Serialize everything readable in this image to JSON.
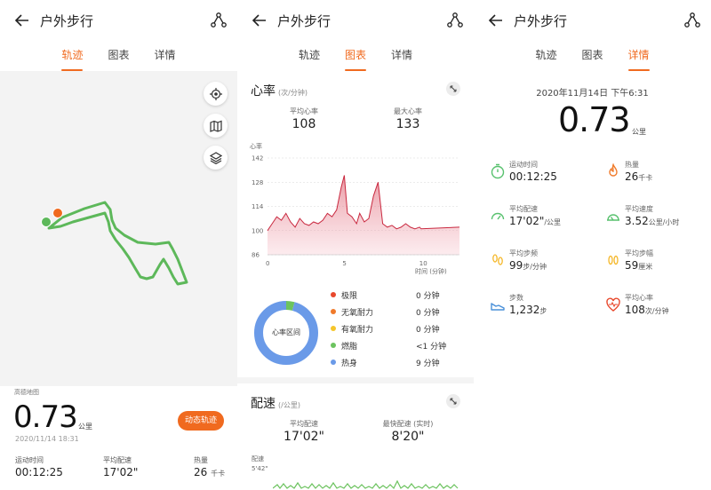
{
  "header": {
    "title": "户外步行"
  },
  "tabs": [
    "轨迹",
    "图表",
    "详情"
  ],
  "summary": {
    "map_source": "高德地图",
    "distance": "0.73",
    "unit": "公里",
    "date": "2020/11/14 18:31",
    "dynamic_button": "动态轨迹",
    "stats": [
      {
        "label": "运动时间",
        "value": "00:12:25",
        "unit": ""
      },
      {
        "label": "平均配速",
        "value": "17'02\"",
        "unit": ""
      },
      {
        "label": "热量",
        "value": "26",
        "unit": "千卡"
      }
    ]
  },
  "heart": {
    "title": "心率",
    "unit": "(次/分钟)",
    "avg_label": "平均心率",
    "avg_value": "108",
    "max_label": "最大心率",
    "max_value": "133",
    "axis_unit": "心率",
    "x_axis_unit": "时间 (分钟)",
    "donut_label": "心率区间",
    "zones": [
      {
        "name": "极限",
        "value": "0 分钟",
        "color": "#e8482c"
      },
      {
        "name": "无氧耐力",
        "value": "0 分钟",
        "color": "#f07a2a"
      },
      {
        "name": "有氧耐力",
        "value": "0 分钟",
        "color": "#f5c52b"
      },
      {
        "name": "燃脂",
        "value": "<1 分钟",
        "color": "#6cc35f"
      },
      {
        "name": "热身",
        "value": "9 分钟",
        "color": "#6a9ae8"
      }
    ]
  },
  "pace": {
    "title": "配速",
    "unit": "(/公里)",
    "avg_label": "平均配速",
    "avg_value": "17'02\"",
    "fast_label": "最快配速 (实时)",
    "fast_value": "8'20\"",
    "axis_unit": "配速",
    "axis_tick": "5'42\""
  },
  "detail": {
    "datetime": "2020年11月14日 下午6:31",
    "distance": "0.73",
    "unit": "公里",
    "metrics": [
      {
        "label": "运动时间",
        "value": "00:12:25",
        "unit": "",
        "icon": "stopwatch-icon",
        "color": "#58c16e"
      },
      {
        "label": "热量",
        "value": "26",
        "unit": "千卡",
        "icon": "flame-icon",
        "color": "#f07a2a"
      },
      {
        "label": "平均配速",
        "value": "17'02\"",
        "unit": "/公里",
        "icon": "speedometer-icon",
        "color": "#58c16e"
      },
      {
        "label": "平均速度",
        "value": "3.52",
        "unit": "公里/小时",
        "icon": "gauge-icon",
        "color": "#58c16e"
      },
      {
        "label": "平均步频",
        "value": "99",
        "unit": "步/分钟",
        "icon": "footprints-icon",
        "color": "#f5b82b"
      },
      {
        "label": "平均步幅",
        "value": "59",
        "unit": "厘米",
        "icon": "stride-icon",
        "color": "#f5b82b"
      },
      {
        "label": "步数",
        "value": "1,232",
        "unit": "步",
        "icon": "shoe-icon",
        "color": "#4a90d9"
      },
      {
        "label": "平均心率",
        "value": "108",
        "unit": "次/分钟",
        "icon": "heart-rate-icon",
        "color": "#e8482c"
      }
    ]
  },
  "chart_data": [
    {
      "type": "area",
      "title": "心率",
      "ylabel": "心率",
      "xlabel": "时间 (分钟)",
      "x_ticks": [
        0,
        5,
        10
      ],
      "y_ticks": [
        86,
        100,
        114,
        128,
        142
      ],
      "xlim": [
        0,
        12.5
      ],
      "ylim": [
        86,
        142
      ],
      "series": [
        {
          "x": [
            0,
            0.3,
            0.6,
            0.9,
            1.2,
            1.5,
            1.8,
            2.1,
            2.4,
            2.7,
            3.0,
            3.3,
            3.6,
            3.9,
            4.2,
            4.5,
            4.8,
            5.0,
            5.2,
            5.5,
            5.8,
            6.0,
            6.3,
            6.6,
            6.9,
            7.2,
            7.5,
            7.8,
            8.1,
            8.4,
            8.7,
            9.0,
            9.3,
            9.6,
            9.9,
            10.0,
            12.5
          ],
          "values": [
            100,
            104,
            108,
            106,
            110,
            105,
            102,
            107,
            104,
            103,
            105,
            104,
            106,
            110,
            108,
            112,
            125,
            132,
            110,
            108,
            104,
            110,
            105,
            107,
            120,
            128,
            104,
            102,
            103,
            101,
            102,
            104,
            102,
            101,
            102,
            101,
            102
          ]
        }
      ]
    },
    {
      "type": "pie",
      "title": "心率区间",
      "categories": [
        "极限",
        "无氧耐力",
        "有氧耐力",
        "燃脂",
        "热身"
      ],
      "values": [
        0,
        0,
        0,
        0.4,
        9
      ]
    }
  ]
}
